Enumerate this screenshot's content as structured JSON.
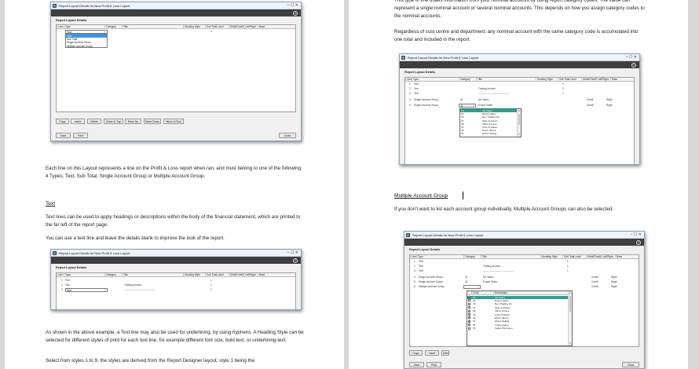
{
  "dialog_title": "Report Layout Details for New Profit & Loss Layout",
  "help_glyph": "?",
  "section_title": "Report Layout Details",
  "columns": [
    "Line",
    "Type",
    "Category",
    "Title",
    "Heading Style",
    "Sub Total Level",
    "Debit/Credit",
    "Left/Right",
    "Base"
  ],
  "buttons": {
    "copy": "Copy",
    "insert": "Insert",
    "delete": "Delete",
    "move_to_top": "Move to Top",
    "move_up": "Move Up",
    "move_down": "Move Down",
    "move_to_end": "Move to End",
    "save": "Save",
    "print": "Print",
    "close": "Close"
  },
  "left_page": {
    "dialog1": {
      "combo_value": "Text",
      "row_heading_style": "1",
      "type_options": [
        "Text",
        "Sub Total",
        "Single Account Group",
        "Multiple Account Group"
      ],
      "selected_option": "Text"
    },
    "paragraph1": "Each line on this Layout represents a line on the Profit & Loss report when ran, and must belong to one of the following 4 Types; Text, Sub Total, Single Account Group or Multiple Account Group.",
    "text_heading": "Text",
    "paragraph2": "Text lines can be used to apply headings or descriptions within the body of the financial statement, which are printed to the far left of the report page.",
    "paragraph3": "You can use a text line and leave the details blank to improve the look of the report.",
    "dialog2": {
      "rows": [
        {
          "line": "1",
          "type": "Text",
          "title": "",
          "style": "1"
        },
        {
          "line": "2",
          "type": "Text",
          "title": "Trading Income",
          "style": "1"
        },
        {
          "line": "3",
          "type": "Text",
          "title": "-------------------------------------",
          "style": "1"
        }
      ]
    },
    "paragraph4": "As shown in the above example, a Text line may also be used for underlining, by using hyphens. A Heading Style can be selected for different styles of print for each text line, for example different font size, bold text, or underlining text.",
    "paragraph5": "Select from styles 1 to 9, the styles are derived from the Report Designer layout, style 1 being the"
  },
  "right_page": {
    "paragraph1": "This type of line draws information from your nominal accounts by using report category codes. The value can represent a single nominal account or several nominal accounts. This depends on how you assign category codes to the nominal accounts.",
    "paragraph2": "Regardless of cost centre and department, any nominal account with the same category code is accumulated into one total and included in the report.",
    "dialog3": {
      "rows": [
        {
          "line": "1",
          "type": "Text",
          "cat": "",
          "title": "",
          "style": "1",
          "dc": "",
          "lr": ""
        },
        {
          "line": "2",
          "type": "Text",
          "cat": "",
          "title": "Trading Income",
          "style": "1",
          "dc": "",
          "lr": ""
        },
        {
          "line": "3",
          "type": "Text",
          "cat": "",
          "title": "-------------------------------------",
          "style": "1",
          "dc": "",
          "lr": ""
        },
        {
          "line": "4",
          "type": "Single Account Group",
          "cat": "31",
          "title": "UK Sales",
          "style": "",
          "dc": "Credit",
          "lr": "Right"
        },
        {
          "line": "5",
          "type": "Single Account Group",
          "cat": "32",
          "title": "Export Sales",
          "style": "",
          "dc": "Credit",
          "lr": "Right"
        }
      ],
      "popup": [
        {
          "code": "31",
          "desc": "UK Sales"
        },
        {
          "code": "32",
          "desc": "Export Sales"
        },
        {
          "code": "33",
          "desc": "Non Trading Inc"
        },
        {
          "code": "37",
          "desc": "Sale of Assets"
        },
        {
          "code": "38",
          "desc": "Other Income"
        },
        {
          "code": "41",
          "desc": "Cost Of Sales"
        },
        {
          "code": "42",
          "desc": "Direct labour"
        },
        {
          "code": "51",
          "desc": "Direct Selling"
        }
      ]
    },
    "mag_heading": "Multiple Account Group",
    "paragraph3": "If you don't want to list each account group individually, Multiple Account Groups can also be selected.",
    "dialog4": {
      "rows": [
        {
          "line": "1",
          "type": "Text",
          "cat": "",
          "title": "",
          "style": "1",
          "dc": "",
          "lr": ""
        },
        {
          "line": "2",
          "type": "Text",
          "cat": "",
          "title": "Trading Income",
          "style": "1",
          "dc": "",
          "lr": ""
        },
        {
          "line": "3",
          "type": "Text",
          "cat": "",
          "title": "-------------------------------------",
          "style": "1",
          "dc": "",
          "lr": ""
        },
        {
          "line": "4",
          "type": "Single Account Group",
          "cat": "31",
          "title": "UK Sales",
          "style": "",
          "dc": "Credit",
          "lr": "Right"
        },
        {
          "line": "5",
          "type": "Single Account Group",
          "cat": "32",
          "title": "Export Sales",
          "style": "",
          "dc": "Credit",
          "lr": "Right"
        },
        {
          "line": "6",
          "type": "Multiple Account Group",
          "cat": "",
          "title": "",
          "style": "",
          "dc": "Credit",
          "lr": "Right"
        }
      ],
      "popup_headers": [
        "Code",
        "Description"
      ],
      "popup": [
        {
          "code": "31",
          "desc": "UK Sales",
          "checked": true
        },
        {
          "code": "32",
          "desc": "Export Sales",
          "checked": false
        },
        {
          "code": "33",
          "desc": "Non Trading Inc",
          "checked": false
        },
        {
          "code": "37",
          "desc": "Sale of Assets",
          "checked": false
        },
        {
          "code": "38",
          "desc": "Other Income",
          "checked": false
        },
        {
          "code": "41",
          "desc": "Cost Of Sales",
          "checked": true
        },
        {
          "code": "42",
          "desc": "Direct labour",
          "checked": true
        },
        {
          "code": "51",
          "desc": "Direct Selling",
          "checked": true
        },
        {
          "code": "52",
          "desc": "Travel & Exp",
          "checked": false
        },
        {
          "code": "53",
          "desc": "Sales Promotion",
          "checked": false
        }
      ],
      "truncated_button": "Dele"
    }
  }
}
